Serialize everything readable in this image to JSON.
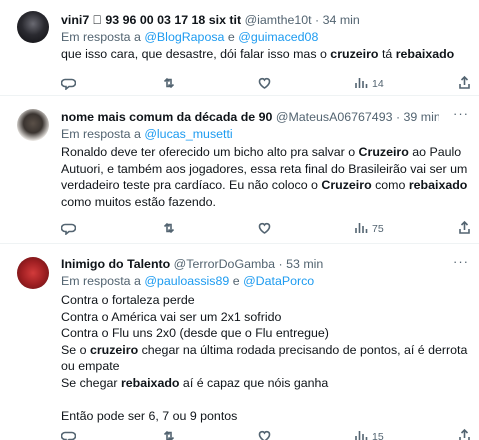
{
  "tweets": [
    {
      "author": "vini7 ⃣ 93 96 00 03 17 18 six tit",
      "handle": "@iamthe10t",
      "separator": "·",
      "time": "34 min",
      "more": "···",
      "reply_prefix": "Em resposta a",
      "reply_to": [
        "@BlogRaposa",
        "@guimaced08"
      ],
      "reply_joiner": "e",
      "body": [
        {
          "segments": [
            {
              "text": "que isso cara, que desastre, dói falar isso mas o ",
              "bold": false
            },
            {
              "text": "cruzeiro",
              "bold": true
            },
            {
              "text": " tá ",
              "bold": false
            },
            {
              "text": "rebaixado",
              "bold": true
            }
          ]
        }
      ],
      "views": "14"
    },
    {
      "author": "nome mais comum da década de 90",
      "handle": "@MateusA06767493",
      "separator": "·",
      "time": "39 min",
      "more": "···",
      "reply_prefix": "Em resposta a",
      "reply_to": [
        "@lucas_musetti"
      ],
      "reply_joiner": "",
      "body": [
        {
          "segments": [
            {
              "text": "Ronaldo deve ter oferecido um bicho alto pra salvar o ",
              "bold": false
            },
            {
              "text": "Cruzeiro",
              "bold": true
            },
            {
              "text": " ao Paulo",
              "bold": false
            }
          ]
        },
        {
          "segments": [
            {
              "text": "Autuori, e também aos jogadores, essa reta final do Brasileirão vai ser um",
              "bold": false
            }
          ]
        },
        {
          "segments": [
            {
              "text": "verdadeiro teste pra cardíaco. Eu não coloco o ",
              "bold": false
            },
            {
              "text": "Cruzeiro",
              "bold": true
            },
            {
              "text": " como ",
              "bold": false
            },
            {
              "text": "rebaixado",
              "bold": true
            }
          ]
        },
        {
          "segments": [
            {
              "text": "como muitos estão fazendo.",
              "bold": false
            }
          ]
        }
      ],
      "views": "75"
    },
    {
      "author": "Inimigo do Talento",
      "handle": "@TerrorDoGamba",
      "separator": "·",
      "time": "53 min",
      "more": "···",
      "reply_prefix": "Em resposta a",
      "reply_to": [
        "@pauloassis89",
        "@DataPorco"
      ],
      "reply_joiner": "e",
      "body": [
        {
          "segments": [
            {
              "text": "Contra o fortaleza perde",
              "bold": false
            }
          ]
        },
        {
          "segments": [
            {
              "text": "Contra o América vai ser um 2x1 sofrido",
              "bold": false
            }
          ]
        },
        {
          "segments": [
            {
              "text": "Contra o Flu uns 2x0 (desde que o Flu entregue)",
              "bold": false
            }
          ]
        },
        {
          "segments": [
            {
              "text": "Se o ",
              "bold": false
            },
            {
              "text": "cruzeiro",
              "bold": true
            },
            {
              "text": " chegar na última rodada precisando de pontos, aí é derrota",
              "bold": false
            }
          ]
        },
        {
          "segments": [
            {
              "text": "ou empate",
              "bold": false
            }
          ]
        },
        {
          "segments": [
            {
              "text": "Se chegar ",
              "bold": false
            },
            {
              "text": "rebaixado",
              "bold": true
            },
            {
              "text": " aí é capaz que nóis ganha",
              "bold": false
            }
          ]
        },
        {
          "segments": [
            {
              "text": "",
              "bold": false
            }
          ]
        },
        {
          "segments": [
            {
              "text": "Então pode ser 6, 7 ou 9 pontos",
              "bold": false
            }
          ]
        }
      ],
      "views": "15"
    }
  ],
  "icons": {
    "reply": "reply-icon",
    "retweet": "retweet-icon",
    "like": "heart-icon",
    "views": "views-icon",
    "share": "share-icon"
  },
  "colors": {
    "link": "#1d9bf0",
    "secondary_text": "#536471",
    "divider": "#eff3f4"
  }
}
